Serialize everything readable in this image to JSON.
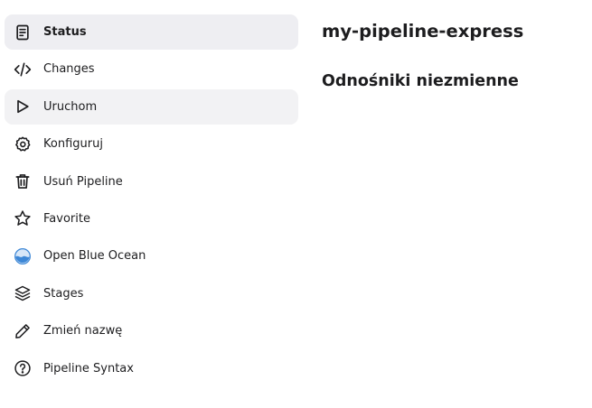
{
  "sidebar": {
    "items": [
      {
        "label": "Status",
        "icon": "document-icon",
        "state": "active"
      },
      {
        "label": "Changes",
        "icon": "code-icon",
        "state": "normal"
      },
      {
        "label": "Uruchom",
        "icon": "play-icon",
        "state": "hover"
      },
      {
        "label": "Konfiguruj",
        "icon": "gear-icon",
        "state": "normal"
      },
      {
        "label": "Usuń Pipeline",
        "icon": "trash-icon",
        "state": "normal"
      },
      {
        "label": "Favorite",
        "icon": "star-icon",
        "state": "normal"
      },
      {
        "label": "Open Blue Ocean",
        "icon": "blue-ocean-icon",
        "state": "normal"
      },
      {
        "label": "Stages",
        "icon": "layers-icon",
        "state": "normal"
      },
      {
        "label": "Zmień nazwę",
        "icon": "pencil-icon",
        "state": "normal"
      },
      {
        "label": "Pipeline Syntax",
        "icon": "help-icon",
        "state": "normal"
      }
    ]
  },
  "main": {
    "title": "my-pipeline-express",
    "section_title": "Odnośniki niezmienne"
  },
  "colors": {
    "active_bg": "#eeeef2",
    "hover_bg": "#f2f2f4",
    "text": "#1d1d1f",
    "blue_ocean": "#3d87d6"
  }
}
